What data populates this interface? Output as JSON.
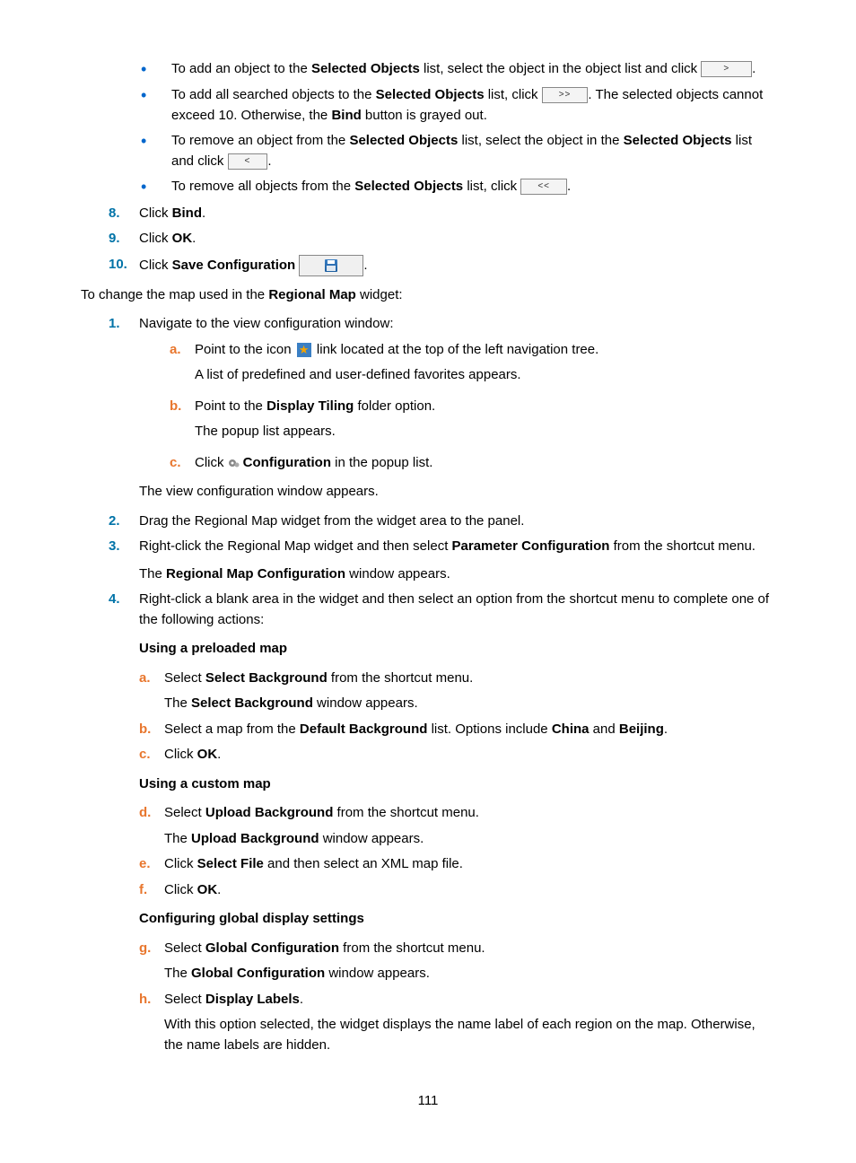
{
  "bullets": [
    {
      "pre": "To add an object to the ",
      "b1": "Selected Objects",
      "mid": " list, select the object in the object list and click ",
      "btn": ">",
      "post": "."
    },
    {
      "pre": "To add all searched objects to the ",
      "b1": "Selected Objects",
      "mid": " list, click ",
      "btn": ">>",
      "post": ". The selected objects cannot exceed 10. Otherwise, the ",
      "b2": "Bind",
      "post2": " button is grayed out."
    },
    {
      "pre": "To remove an object from the ",
      "b1": "Selected Objects",
      "mid": " list, select the object in the ",
      "b2": "Selected Objects",
      "mid2": " list and click ",
      "btn": "<",
      "post": "."
    },
    {
      "pre": "To remove all objects from the ",
      "b1": "Selected Objects",
      "mid": " list, click ",
      "btn": "<<",
      "post": "."
    }
  ],
  "step8": {
    "num": "8.",
    "pre": "Click ",
    "b": "Bind",
    "post": "."
  },
  "step9": {
    "num": "9.",
    "pre": "Click ",
    "b": "OK",
    "post": "."
  },
  "step10": {
    "num": "10.",
    "pre": "Click ",
    "b": "Save Configuration",
    "post": "."
  },
  "change_intro": {
    "pre": "To change the map used in the ",
    "b": "Regional Map",
    "post": " widget:"
  },
  "s1": {
    "num": "1.",
    "text": "Navigate to the view configuration window:"
  },
  "s1a": {
    "l": "a.",
    "pre": "Point to the icon ",
    "post": " link located at the top of the left navigation tree.",
    "follow": "A list of predefined and user-defined favorites appears."
  },
  "s1b": {
    "l": "b.",
    "pre": "Point to the ",
    "b": "Display Tiling",
    "post": " folder option.",
    "follow": "The popup list appears."
  },
  "s1c": {
    "l": "c.",
    "pre": "Click ",
    "b": "Configuration",
    "post": " in the popup list."
  },
  "s1_follow": "The view configuration window appears.",
  "s2": {
    "num": "2.",
    "text": "Drag the Regional Map widget from the widget area to the panel."
  },
  "s3": {
    "num": "3.",
    "pre": "Right-click the Regional Map widget and then select ",
    "b": "Parameter Configuration",
    "post": " from the shortcut menu.",
    "follow_pre": "The ",
    "follow_b": "Regional Map Configuration",
    "follow_post": " window appears."
  },
  "s4": {
    "num": "4.",
    "text": "Right-click a blank area in the widget and then select an option from the shortcut menu to complete one of the following actions:"
  },
  "h_preloaded": "Using a preloaded map",
  "s4a": {
    "l": "a.",
    "pre": "Select ",
    "b": "Select Background",
    "post": " from the shortcut menu.",
    "follow_pre": "The ",
    "follow_b": "Select Background",
    "follow_post": " window appears."
  },
  "s4b": {
    "l": "b.",
    "pre": "Select a map from the ",
    "b": "Default Background",
    "mid": " list. Options include ",
    "b2": "China",
    "mid2": " and ",
    "b3": "Beijing",
    "post": "."
  },
  "s4c": {
    "l": "c.",
    "pre": "Click ",
    "b": "OK",
    "post": "."
  },
  "h_custom": "Using a custom map",
  "s4d": {
    "l": "d.",
    "pre": "Select ",
    "b": "Upload Background",
    "post": " from the shortcut menu.",
    "follow_pre": "The ",
    "follow_b": "Upload Background",
    "follow_post": " window appears."
  },
  "s4e": {
    "l": "e.",
    "pre": "Click ",
    "b": "Select File",
    "post": " and then select an XML map file."
  },
  "s4f": {
    "l": "f.",
    "pre": "Click ",
    "b": "OK",
    "post": "."
  },
  "h_global": "Configuring global display settings",
  "s4g": {
    "l": "g.",
    "pre": "Select ",
    "b": "Global Configuration",
    "post": " from the shortcut menu.",
    "follow_pre": "The ",
    "follow_b": "Global Configuration",
    "follow_post": " window appears."
  },
  "s4h": {
    "l": "h.",
    "pre": "Select ",
    "b": "Display Labels",
    "post": ".",
    "follow": "With this option selected, the widget displays the name label of each region on the map. Otherwise, the name labels are hidden."
  },
  "page_number": "111"
}
